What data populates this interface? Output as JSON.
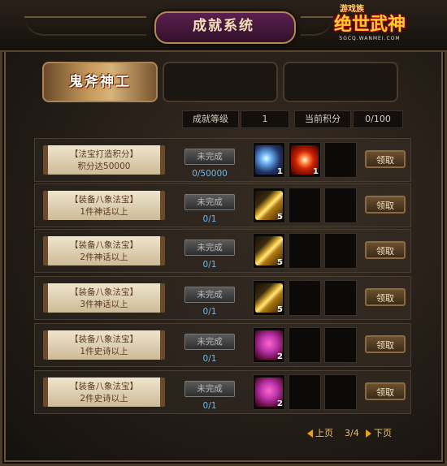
{
  "window": {
    "title": "成就系统",
    "logo_main": "绝世武神",
    "logo_small": "游戏族",
    "logo_url": "SGCQ.WANMEI.COM"
  },
  "tabs": [
    {
      "label": "鬼斧神工",
      "active": true
    },
    {
      "label": "",
      "active": false
    },
    {
      "label": "",
      "active": false
    }
  ],
  "stats": {
    "level_label": "成就等级",
    "level_value": "1",
    "score_label": "当前积分",
    "score_value": "0/100"
  },
  "rows": [
    {
      "line1": "【法宝打造积分】",
      "line2": "积分达50000",
      "status": "未完成",
      "progress": "0/50000",
      "rewards": [
        {
          "icon": "blue-orb-icon",
          "count": "1"
        },
        {
          "icon": "red-burst-icon",
          "count": "1"
        },
        {
          "icon": "",
          "count": ""
        }
      ],
      "claim": "领取"
    },
    {
      "line1": "【装备八象法宝】",
      "line2": "1件神话以上",
      "status": "未完成",
      "progress": "0/1",
      "rewards": [
        {
          "icon": "golden-tube-icon",
          "count": "5"
        },
        {
          "icon": "",
          "count": ""
        },
        {
          "icon": "",
          "count": ""
        }
      ],
      "claim": "领取"
    },
    {
      "line1": "【装备八象法宝】",
      "line2": "2件神话以上",
      "status": "未完成",
      "progress": "0/1",
      "rewards": [
        {
          "icon": "golden-tube-icon",
          "count": "5"
        },
        {
          "icon": "",
          "count": ""
        },
        {
          "icon": "",
          "count": ""
        }
      ],
      "claim": "领取"
    },
    {
      "line1": "【装备八象法宝】",
      "line2": "3件神话以上",
      "status": "未完成",
      "progress": "0/1",
      "rewards": [
        {
          "icon": "golden-tube-icon",
          "count": "5"
        },
        {
          "icon": "",
          "count": ""
        },
        {
          "icon": "",
          "count": ""
        }
      ],
      "claim": "领取"
    },
    {
      "line1": "【装备八象法宝】",
      "line2": "1件史诗以上",
      "status": "未完成",
      "progress": "0/1",
      "rewards": [
        {
          "icon": "magic-scroll-icon",
          "count": "2"
        },
        {
          "icon": "",
          "count": ""
        },
        {
          "icon": "",
          "count": ""
        }
      ],
      "claim": "领取"
    },
    {
      "line1": "【装备八象法宝】",
      "line2": "2件史诗以上",
      "status": "未完成",
      "progress": "0/1",
      "rewards": [
        {
          "icon": "magic-scroll-icon",
          "count": "2"
        },
        {
          "icon": "",
          "count": ""
        },
        {
          "icon": "",
          "count": ""
        }
      ],
      "claim": "领取"
    }
  ],
  "pager": {
    "prev": "上页",
    "page": "3/4",
    "next": "下页"
  }
}
